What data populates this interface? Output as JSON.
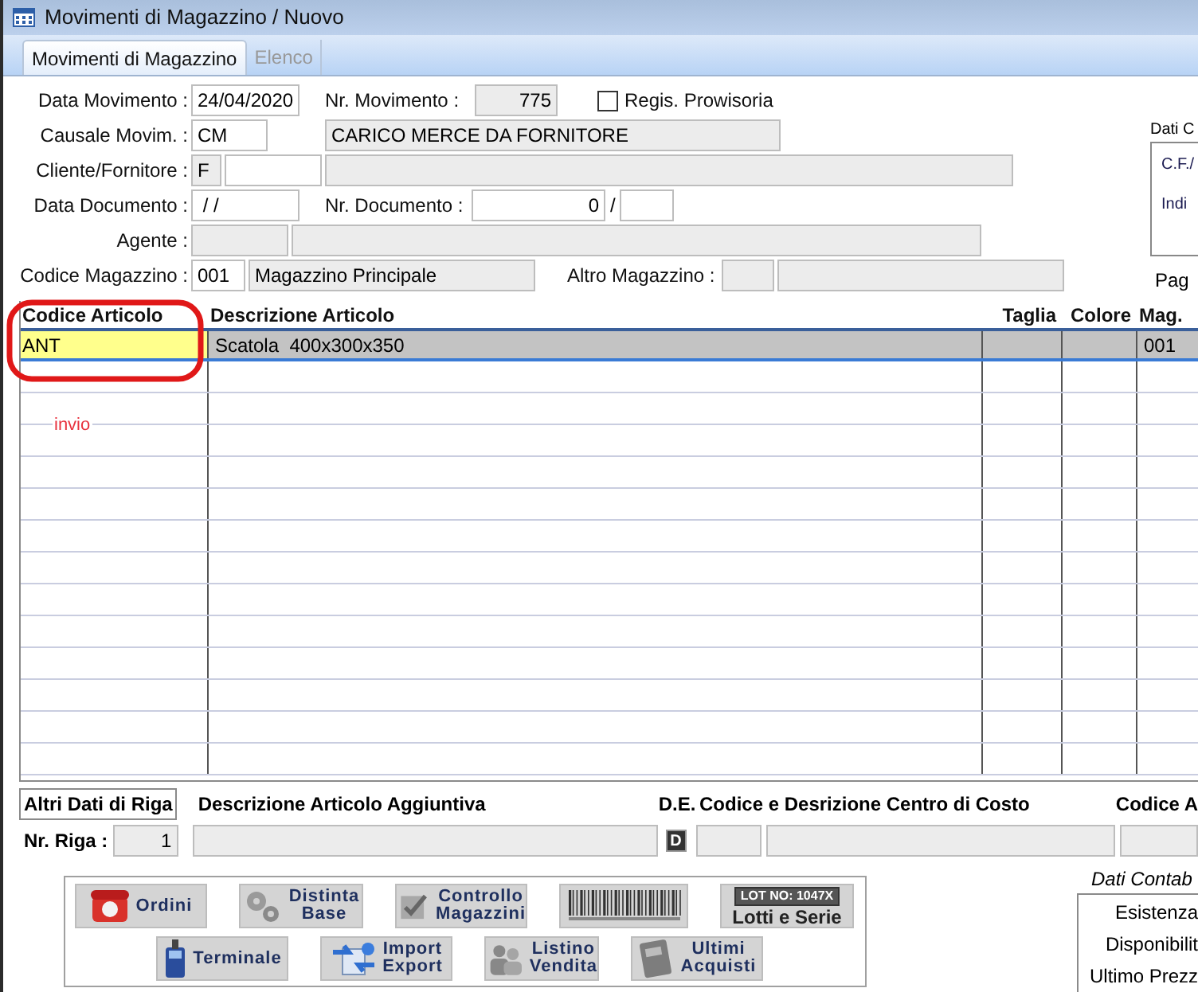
{
  "window": {
    "title": "Movimenti di Magazzino / Nuovo"
  },
  "tabs": [
    {
      "label": "Movimenti di Magazzino",
      "selected": true
    },
    {
      "label": "Elenco",
      "selected": false
    }
  ],
  "header": {
    "data_movimento": {
      "label": "Data Movimento :",
      "value": "24/04/2020"
    },
    "nr_movimento": {
      "label": "Nr. Movimento :",
      "value": "775"
    },
    "regis_provvisoria": {
      "label": "Regis. Prowisoria",
      "checked": false
    },
    "causale": {
      "label": "Causale Movim. :",
      "code": "CM",
      "description": "CARICO MERCE DA FORNITORE"
    },
    "cliente": {
      "label": "Cliente/Fornitore :",
      "type": "F"
    },
    "data_documento": {
      "label": "Data Documento :",
      "value": " / /"
    },
    "nr_documento": {
      "label": "Nr. Documento :",
      "value": "0",
      "separator": "/"
    },
    "agente": {
      "label": "Agente :"
    },
    "codice_magazzino": {
      "label": "Codice Magazzino :",
      "code": "001",
      "description": "Magazzino Principale"
    },
    "altro_magazzino": {
      "label": "Altro Magazzino :"
    }
  },
  "side_panel": {
    "title": "Dati C",
    "lines": [
      "C.F./",
      "Indi"
    ],
    "footer": "Pag"
  },
  "table": {
    "columns": [
      "Codice Articolo",
      "Descrizione Articolo",
      "Taglia",
      "Colore",
      "Mag."
    ],
    "rows": [
      {
        "codice": "ANT",
        "descrizione": "Scatola  400x300x350",
        "mag": "001",
        "selected": true
      }
    ]
  },
  "annotation": {
    "text": "invio"
  },
  "row_details": {
    "tab": "Altri Dati di Riga",
    "columns": [
      "Descrizione Articolo Aggiuntiva",
      "D.E.",
      "Codice e Desrizione Centro di Costo",
      "Codice A"
    ],
    "nr_riga_label": "Nr. Riga :",
    "nr_riga": "1",
    "de_button": "D"
  },
  "buttons": [
    [
      {
        "kind": "phone",
        "lines": [
          "Ordini"
        ]
      },
      {
        "kind": "gears",
        "lines": [
          "Distinta",
          "Base"
        ]
      },
      {
        "kind": "check",
        "lines": [
          "Controllo",
          "Magazzini"
        ]
      },
      {
        "kind": "barcode"
      },
      {
        "kind": "lot",
        "badge": "LOT NO: 1047X",
        "lines": [
          "Lotti e Serie"
        ]
      }
    ],
    [
      {
        "kind": "terminal",
        "lines": [
          "Terminale"
        ]
      },
      {
        "kind": "import",
        "lines": [
          "Import",
          "Export"
        ]
      },
      {
        "kind": "people",
        "lines": [
          "Listino",
          "Vendita"
        ]
      },
      {
        "kind": "book",
        "lines": [
          "Ultimi",
          "Acquisti"
        ]
      }
    ]
  ],
  "accounting": {
    "title": "Dati Contab",
    "lines": [
      "Esistenza",
      "Disponibilit",
      "Ultimo Prezz"
    ]
  }
}
